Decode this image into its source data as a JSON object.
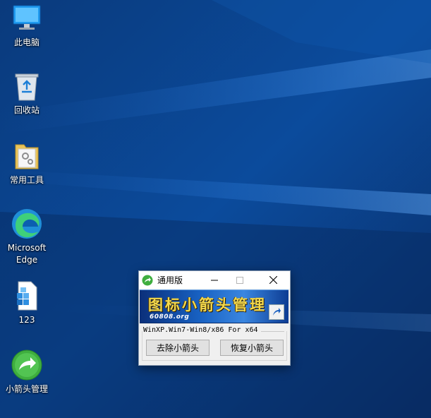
{
  "desktop": {
    "icons": [
      {
        "label": "此电脑",
        "icon": "computer-icon"
      },
      {
        "label": "回收站",
        "icon": "recycle-bin-icon"
      },
      {
        "label": "常用工具",
        "icon": "folder-icon"
      },
      {
        "label": "Microsoft Edge",
        "icon": "edge-icon"
      },
      {
        "label": "123",
        "icon": "registry-file-icon"
      },
      {
        "label": "小箭头管理",
        "icon": "green-arrow-icon"
      }
    ]
  },
  "window": {
    "title": "通用版",
    "banner": {
      "title": "图标小箭头管理",
      "site": "60808.org"
    },
    "version_text": "WinXP.Win7-Win8/x86 For x64",
    "buttons": {
      "remove": "去除小箭头",
      "restore": "恢复小箭头"
    }
  },
  "colors": {
    "wallpaper_base": "#0a3f86",
    "banner_text": "#f3d84c",
    "app_icon_green": "#3fae3f"
  }
}
